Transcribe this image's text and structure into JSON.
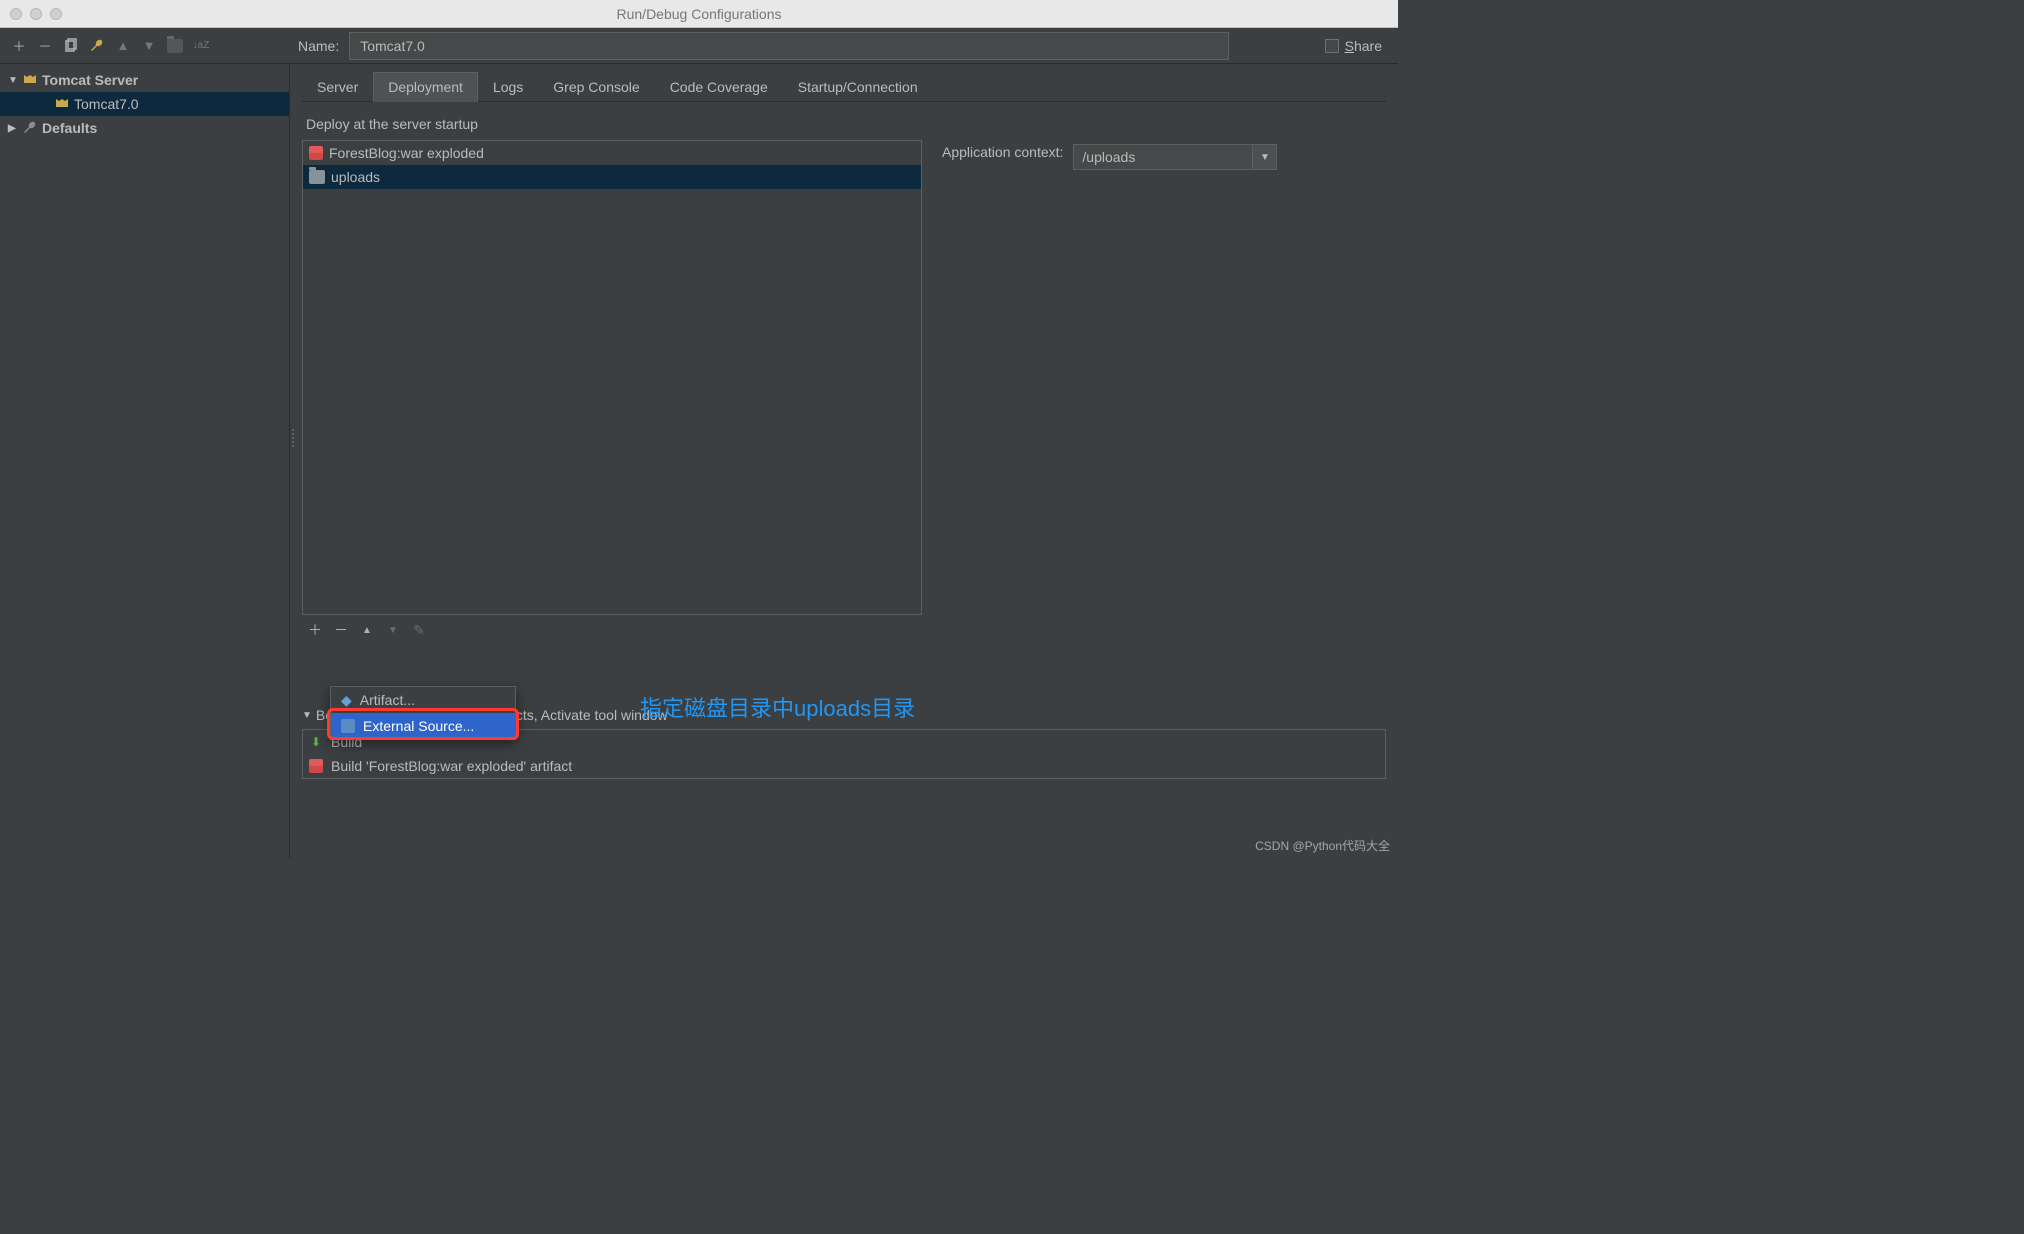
{
  "window": {
    "title": "Run/Debug Configurations"
  },
  "name_field": {
    "label": "Name:",
    "value": "Tomcat7.0"
  },
  "share": {
    "label": "Share"
  },
  "sidebar": {
    "items": [
      {
        "label": "Tomcat Server"
      },
      {
        "label": "Tomcat7.0"
      },
      {
        "label": "Defaults"
      }
    ]
  },
  "tabs": [
    {
      "label": "Server"
    },
    {
      "label": "Deployment"
    },
    {
      "label": "Logs"
    },
    {
      "label": "Grep Console"
    },
    {
      "label": "Code Coverage"
    },
    {
      "label": "Startup/Connection"
    }
  ],
  "deploy": {
    "section_label": "Deploy at the server startup",
    "items": [
      {
        "label": "ForestBlog:war exploded"
      },
      {
        "label": "uploads"
      }
    ],
    "context_label": "Application context:",
    "context_value": "/uploads"
  },
  "popup": {
    "items": [
      {
        "label": "Artifact..."
      },
      {
        "label": "External Source..."
      }
    ]
  },
  "annotation_text": "指定磁盘目录中uploads目录",
  "before_launch": {
    "header": "Before launch: Build, Build Artifacts, Activate tool window",
    "items": [
      {
        "label": "Build"
      },
      {
        "label": "Build 'ForestBlog:war exploded' artifact"
      }
    ]
  },
  "watermark": "CSDN @Python代码大全"
}
